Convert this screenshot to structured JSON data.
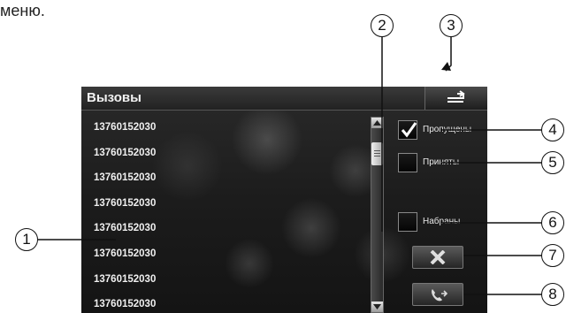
{
  "header_text": "меню.",
  "screen": {
    "title": "Вызовы",
    "back_icon": "return-arrow-icon",
    "calls": [
      "13760152030",
      "13760152030",
      "13760152030",
      "13760152030",
      "13760152030",
      "13760152030",
      "13760152030",
      "13760152030"
    ],
    "filters": [
      {
        "label": "Пропущены",
        "checked": true
      },
      {
        "label": "Приняты",
        "checked": false
      },
      {
        "label": "Набраны",
        "checked": false
      }
    ],
    "delete_icon": "delete-x-icon",
    "call_icon": "phone-call-icon"
  },
  "callouts": [
    "1",
    "2",
    "3",
    "4",
    "5",
    "6",
    "7",
    "8"
  ]
}
